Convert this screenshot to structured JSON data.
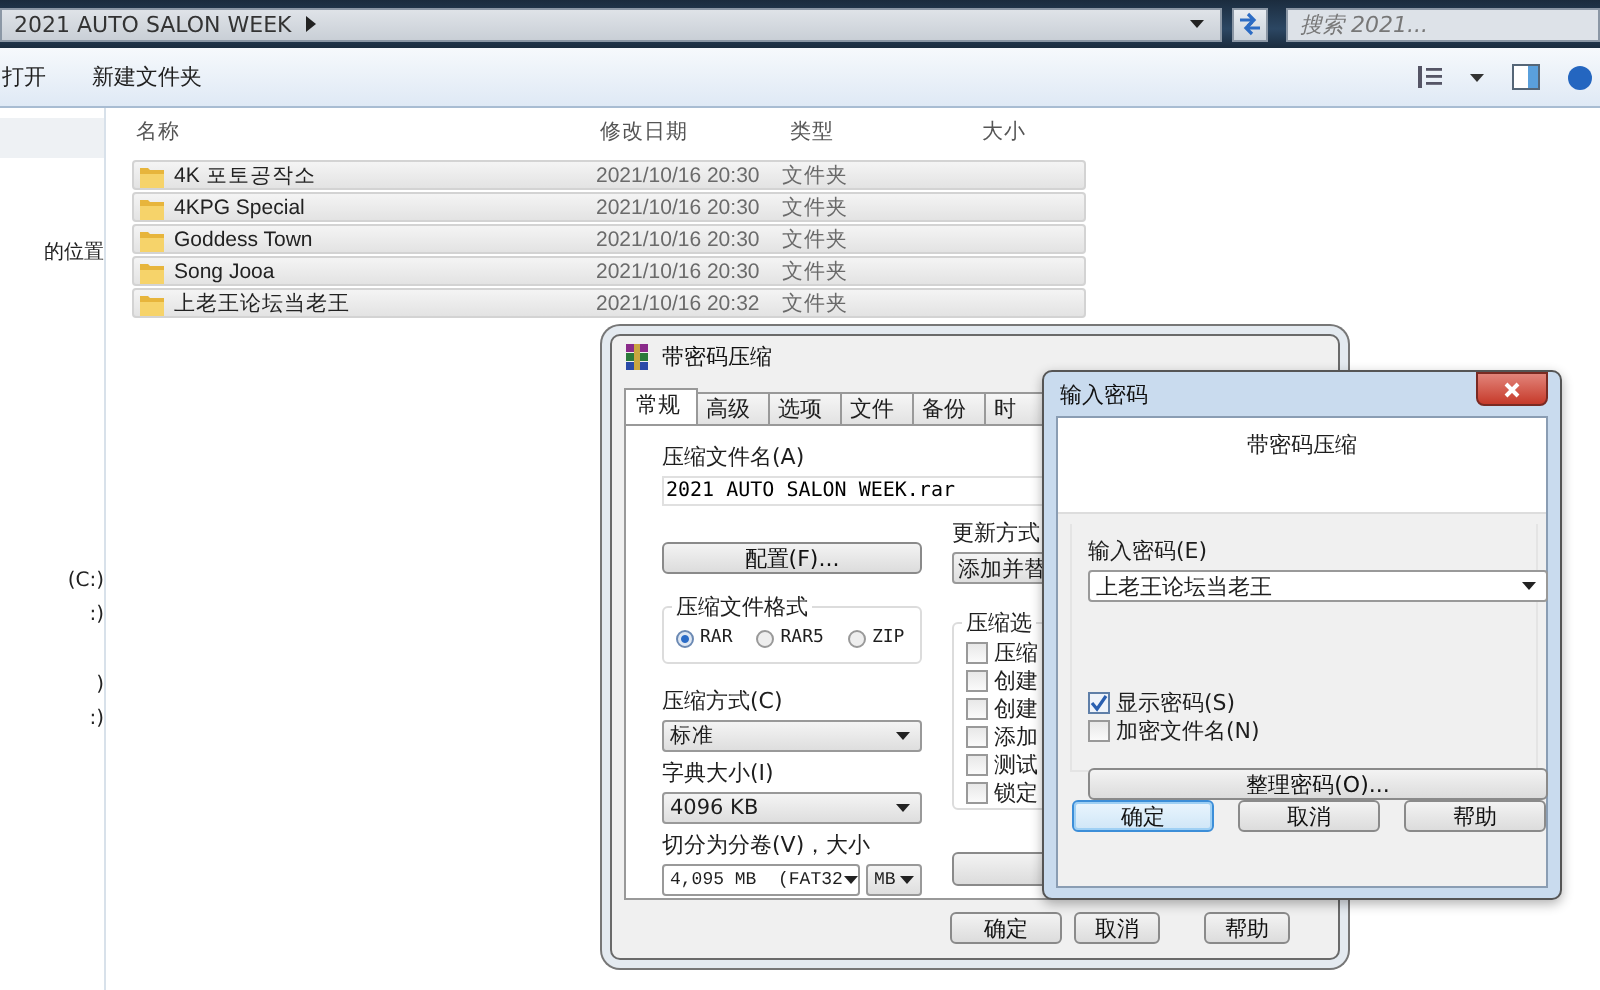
{
  "explorer": {
    "address": {
      "path": "2021 AUTO SALON WEEK"
    },
    "search": {
      "placeholder": "搜索 2021..."
    },
    "toolbar": {
      "buttons": [
        "打开",
        "新建文件夹"
      ]
    },
    "nav": {
      "items": [
        "的位置",
        "(C:)",
        ":)",
        ")",
        ":)"
      ]
    },
    "file_list": {
      "columns": [
        "名称",
        "修改日期",
        "类型",
        "大小"
      ],
      "rows": [
        {
          "name": "4K 포토공작소",
          "modified": "2021/10/16 20:30",
          "type": "文件夹",
          "selected": true
        },
        {
          "name": "4KPG Special",
          "modified": "2021/10/16 20:30",
          "type": "文件夹",
          "selected": true
        },
        {
          "name": "Goddess Town",
          "modified": "2021/10/16 20:30",
          "type": "文件夹",
          "selected": true
        },
        {
          "name": "Song Jooa",
          "modified": "2021/10/16 20:30",
          "type": "文件夹",
          "selected": true
        },
        {
          "name": "上老王论坛当老王",
          "modified": "2021/10/16 20:32",
          "type": "文件夹",
          "selected": true
        }
      ]
    }
  },
  "archive_dialog": {
    "title": "带密码压缩",
    "tabs": [
      {
        "label": "常规",
        "selected": true
      },
      {
        "label": "高级",
        "selected": false
      },
      {
        "label": "选项",
        "selected": false
      },
      {
        "label": "文件",
        "selected": false
      },
      {
        "label": "备份",
        "selected": false
      },
      {
        "label": "时",
        "selected": false
      }
    ],
    "archive_name": {
      "label": "压缩文件名(A)",
      "value": "2021 AUTO SALON WEEK.rar"
    },
    "profiles_button": "配置(F)...",
    "update_mode": {
      "label": "更新方式",
      "value": "添加并替"
    },
    "format": {
      "label": "压缩文件格式",
      "options": [
        {
          "label": "RAR",
          "selected": true
        },
        {
          "label": "RAR5",
          "selected": false
        },
        {
          "label": "ZIP",
          "selected": false
        }
      ]
    },
    "method": {
      "label": "压缩方式(C)",
      "value": "标准"
    },
    "dictionary": {
      "label": "字典大小(I)",
      "value": "4096 KB"
    },
    "split": {
      "label": "切分为分卷(V)，大小",
      "value": "4,095 MB  (FAT32",
      "unit": "MB"
    },
    "options": {
      "label": "压缩选",
      "items": [
        {
          "label": "压缩",
          "checked": false
        },
        {
          "label": "创建",
          "checked": false
        },
        {
          "label": "创建",
          "checked": false
        },
        {
          "label": "添加",
          "checked": false
        },
        {
          "label": "测试",
          "checked": false
        },
        {
          "label": "锁定",
          "checked": false
        }
      ]
    },
    "buttons": [
      "确定",
      "取消",
      "帮助"
    ]
  },
  "password_dialog": {
    "title": "输入密码",
    "heading": "带密码压缩",
    "password": {
      "label": "输入密码(E)",
      "value": "上老王论坛当老王"
    },
    "checkboxes": [
      {
        "label": "显示密码(S)",
        "checked": true
      },
      {
        "label": "加密文件名(N)",
        "checked": false
      }
    ],
    "organize_button": "整理密码(O)...",
    "buttons": [
      {
        "label": "确定",
        "default": true
      },
      {
        "label": "取消",
        "default": false
      },
      {
        "label": "帮助",
        "default": false
      }
    ]
  }
}
